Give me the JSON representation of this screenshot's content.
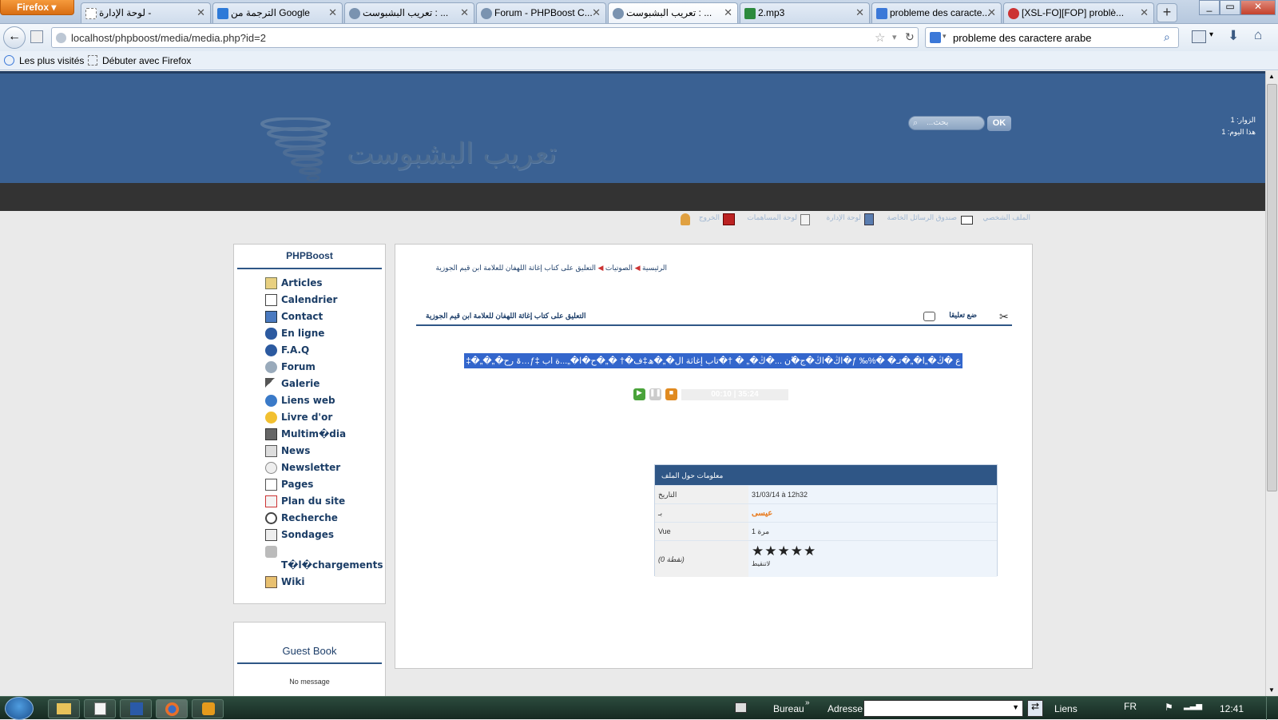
{
  "browser": {
    "app_button": "Firefox",
    "tabs": [
      {
        "label": "لوحة الإدارة -"
      },
      {
        "label": "الترجمة من Google"
      },
      {
        "label": "تعريب البشبوست : ..."
      },
      {
        "label": "Forum - PHPBoost C..."
      },
      {
        "label": "تعريب البشبوست : ..."
      },
      {
        "label": "2.mp3"
      },
      {
        "label": "probleme des caracte..."
      },
      {
        "label": "[XSL-FO][FOP] problè..."
      }
    ],
    "new_tab": "+",
    "url": "localhost/phpboost/media/media.php?id=2",
    "search_value": "probleme des caractere arabe",
    "bookmarks": [
      {
        "label": "Les plus visités"
      },
      {
        "label": "Débuter avec Firefox"
      }
    ]
  },
  "header": {
    "logo_text": "تعريب البشبوست",
    "search_placeholder": "...بحث",
    "ok_label": "OK",
    "visitors_total": "الزوار: 1",
    "visitors_today": "هذا اليوم: 1"
  },
  "userlinks": [
    {
      "label": "الملف الشخصي"
    },
    {
      "label": "صندوق الرسائل الخاصة"
    },
    {
      "label": "لوحة الإدارة"
    },
    {
      "label": "لوحة المساهمات"
    },
    {
      "label": "الخروج"
    }
  ],
  "sidebar": {
    "title": "PHPBoost",
    "items": [
      {
        "label": "Articles"
      },
      {
        "label": "Calendrier"
      },
      {
        "label": "Contact"
      },
      {
        "label": "En ligne"
      },
      {
        "label": "F.A.Q"
      },
      {
        "label": "Forum"
      },
      {
        "label": "Galerie"
      },
      {
        "label": "Liens web"
      },
      {
        "label": "Livre d'or"
      },
      {
        "label": "Multim�dia"
      },
      {
        "label": "News"
      },
      {
        "label": "Newsletter"
      },
      {
        "label": "Pages"
      },
      {
        "label": "Plan du site"
      },
      {
        "label": "Recherche"
      },
      {
        "label": "Sondages"
      },
      {
        "label": "T�l�chargements"
      },
      {
        "label": "Wiki"
      }
    ]
  },
  "guestbook": {
    "title": "Guest Book",
    "message": "No message"
  },
  "main": {
    "breadcrumb": [
      "الرئيسية",
      "الصوتيات",
      "التعليق على كتاب إغاثة اللهفان للعلامة ابن قيم الجوزية"
    ],
    "title": "التعليق على كتاب إغاثة اللهفان للعلامة ابن قيم الجوزية",
    "comment_link": "ضع تعليقا",
    "garbled_text": "‡�„�„�ۃ رح…ƒ‡ اڭ�اڭ�ج�ّن ...�ڭ�„ � †�تاب إغاثة ال�„�ھ‡ف�†  �„�ح�ا�„...ة اب�ƒ ‰%�  �ع �ڭ�„ا�„�تـ",
    "player_time": "00:10 | 35:24"
  },
  "fileinfo": {
    "title": "معلومات حول الملف",
    "rows": [
      {
        "label": "التاريخ",
        "value": "31/03/14 à 12h32"
      },
      {
        "label": "بـ",
        "value": "عيسى"
      },
      {
        "label": "Vue",
        "value": "مرة 1"
      },
      {
        "label": "(نقطة 0)",
        "value": "لاتنقيط"
      }
    ],
    "stars": 5
  },
  "taskbar": {
    "bureau": "Bureau",
    "adresse": "Adresse",
    "liens": "Liens",
    "lang": "FR",
    "time": "12:41"
  },
  "colors": {
    "header_blue": "#3a6193",
    "accent_navy": "#2f5686",
    "selection_blue": "#3366cc",
    "author_orange": "#e87a1e"
  }
}
